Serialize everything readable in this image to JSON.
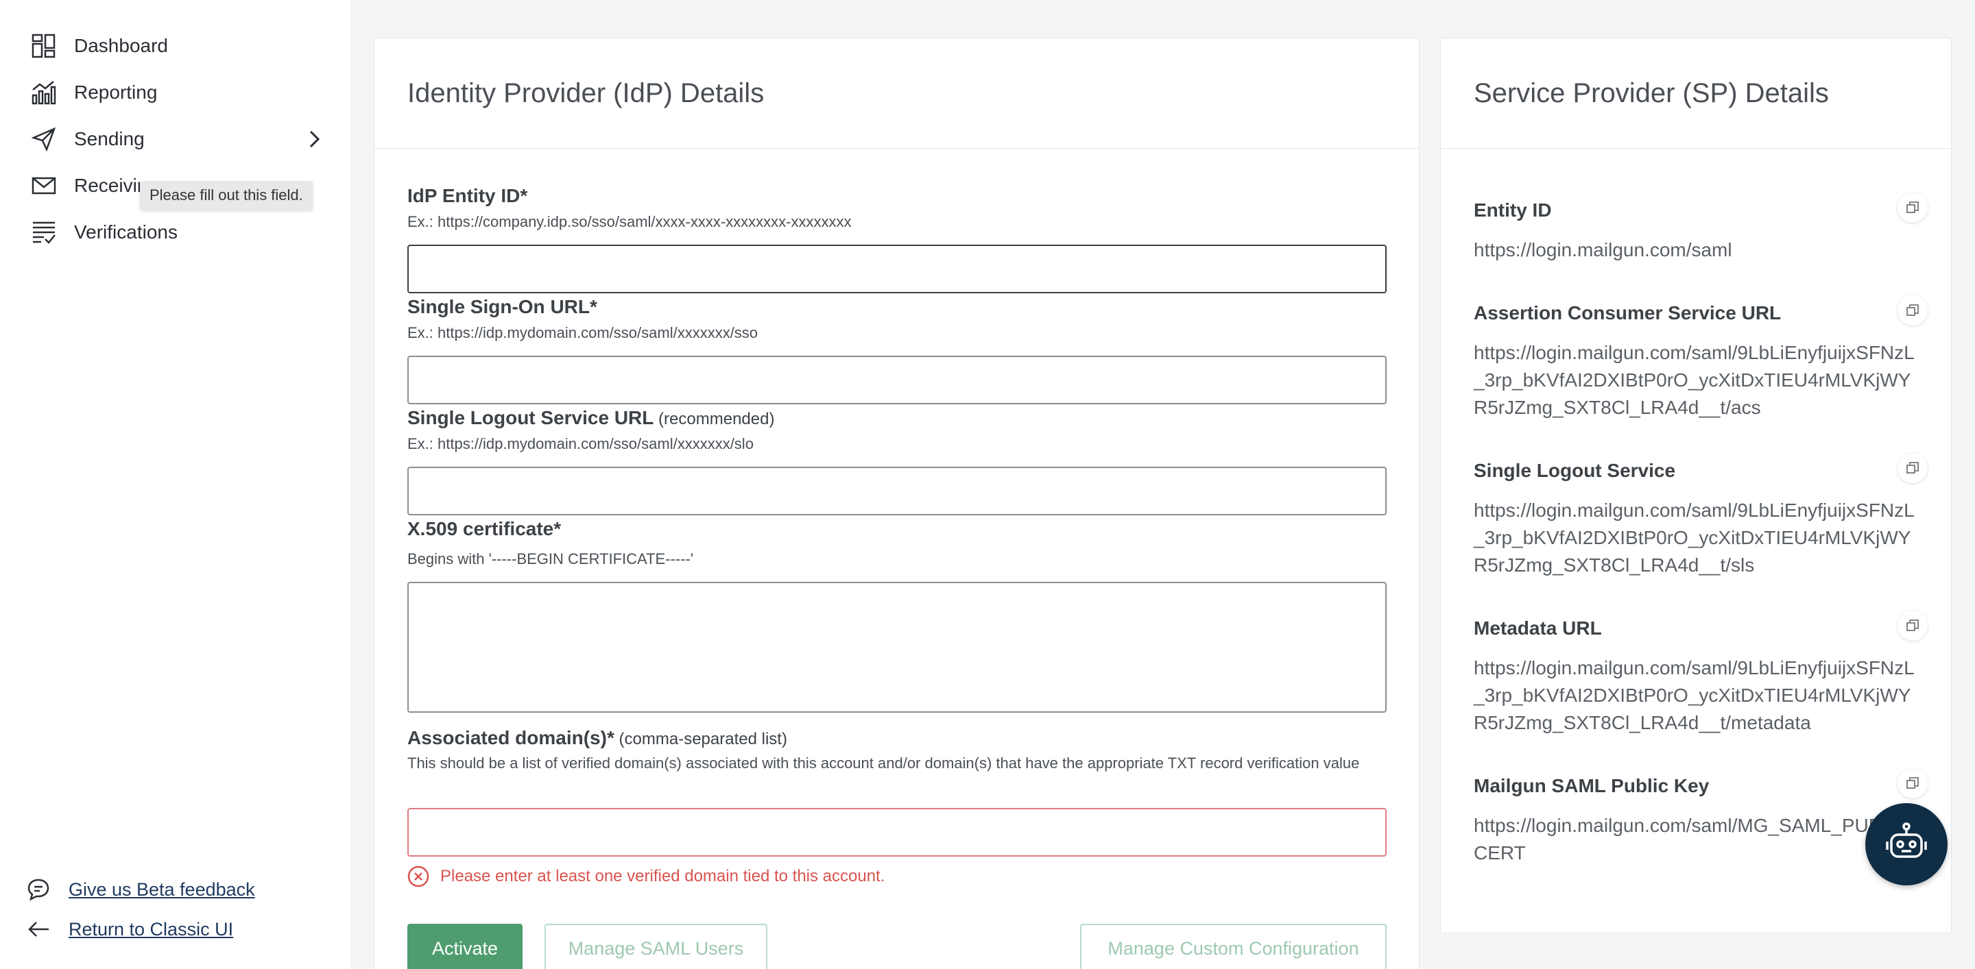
{
  "sidebar": {
    "items": [
      {
        "label": "Dashboard",
        "icon": "dashboard-icon"
      },
      {
        "label": "Reporting",
        "icon": "reporting-icon"
      },
      {
        "label": "Sending",
        "icon": "send-icon"
      },
      {
        "label": "Receivir",
        "icon": "mail-icon"
      },
      {
        "label": "Verifications",
        "icon": "verifications-icon"
      }
    ],
    "tooltip": "Please fill out this field.",
    "feedback_link": "Give us Beta feedback",
    "classic_link": "Return to Classic UI"
  },
  "idp": {
    "title": "Identity Provider (IdP) Details",
    "entity_id": {
      "label": "IdP Entity ID*",
      "help": "Ex.: https://company.idp.so/sso/saml/xxxx-xxxx-xxxxxxxx-xxxxxxxx",
      "value": ""
    },
    "sso_url": {
      "label": "Single Sign-On URL*",
      "help": "Ex.: https://idp.mydomain.com/sso/saml/xxxxxxx/sso",
      "value": ""
    },
    "slo_url": {
      "label": "Single Logout Service URL",
      "sublabel": " (recommended)",
      "help": "Ex.: https://idp.mydomain.com/sso/saml/xxxxxxx/slo",
      "value": ""
    },
    "certificate": {
      "label": "X.509 certificate*",
      "help": "Begins with '-----BEGIN CERTIFICATE-----'",
      "value": ""
    },
    "domains": {
      "label": "Associated domain(s)*",
      "sublabel": " (comma-separated list)",
      "help": "This should be a list of verified domain(s) associated with this account and/or domain(s) that have the appropriate TXT record verification value",
      "value": "",
      "error": "Please enter at least one verified domain tied to this account."
    },
    "buttons": {
      "activate": "Activate",
      "manage_users": "Manage SAML Users",
      "manage_config": "Manage Custom Configuration"
    }
  },
  "sp": {
    "title": "Service Provider (SP) Details",
    "items": [
      {
        "label": "Entity ID",
        "value": "https://login.mailgun.com/saml"
      },
      {
        "label": "Assertion Consumer Service URL",
        "value": "https://login.mailgun.com/saml/9LbLiEnyfjuijxSFNzL_3rp_bKVfAI2DXIBtP0rO_ycXitDxTIEU4rMLVKjWYR5rJZmg_SXT8Cl_LRA4d__t/acs"
      },
      {
        "label": "Single Logout Service",
        "value": "https://login.mailgun.com/saml/9LbLiEnyfjuijxSFNzL_3rp_bKVfAI2DXIBtP0rO_ycXitDxTIEU4rMLVKjWYR5rJZmg_SXT8Cl_LRA4d__t/sls"
      },
      {
        "label": "Metadata URL",
        "value": "https://login.mailgun.com/saml/9LbLiEnyfjuijxSFNzL_3rp_bKVfAI2DXIBtP0rO_ycXitDxTIEU4rMLVKjWYR5rJZmg_SXT8Cl_LRA4d__t/metadata"
      },
      {
        "label": "Mailgun SAML Public Key",
        "value": "https://login.mailgun.com/saml/MG_SAML_PUBLIC_CERT"
      }
    ]
  },
  "colors": {
    "primary": "#4f9d6f",
    "error": "#d9534f",
    "bot": "#0f2d45"
  }
}
